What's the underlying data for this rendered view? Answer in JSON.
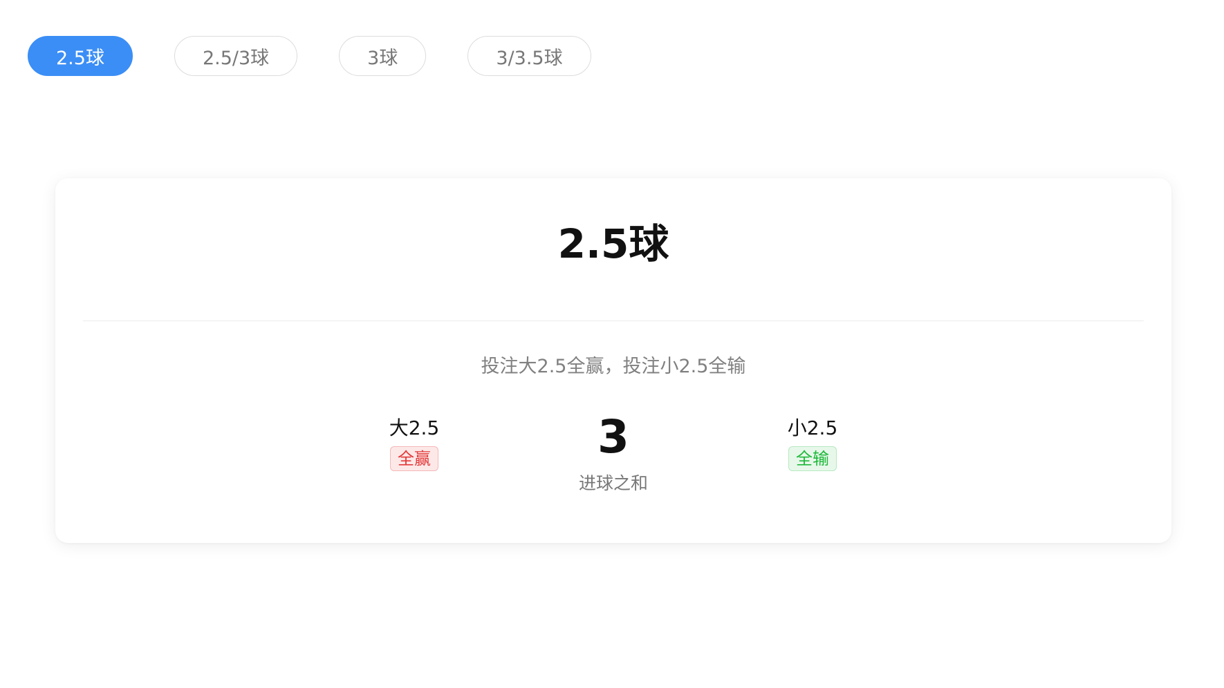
{
  "tabs": [
    {
      "label": "2.5球",
      "active": true
    },
    {
      "label": "2.5/3球",
      "active": false
    },
    {
      "label": "3球",
      "active": false
    },
    {
      "label": "3/3.5球",
      "active": false
    }
  ],
  "card": {
    "title": "2.5球",
    "description": "投注大2.5全赢，投注小2.5全输",
    "over": {
      "label": "大2.5",
      "result": "全赢"
    },
    "total": {
      "value": "3",
      "label": "进球之和"
    },
    "under": {
      "label": "小2.5",
      "result": "全输"
    }
  },
  "colors": {
    "accent": "#3b8ef5",
    "win": "#e23a3a",
    "lose": "#1fb83a"
  }
}
